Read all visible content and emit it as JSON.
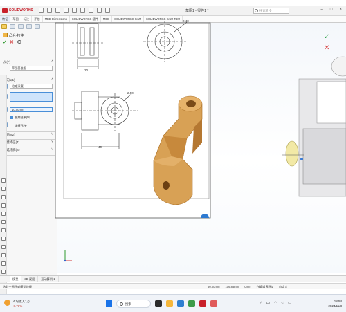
{
  "app": {
    "brand": "SOLIDWORKS",
    "document_title": "草图1 - 零件1 *",
    "search_placeholder": "搜索命令"
  },
  "command_tabs": [
    {
      "label": "特征",
      "active": true
    },
    {
      "label": "草图"
    },
    {
      "label": "标注"
    },
    {
      "label": "评估"
    },
    {
      "label": "MBD Dimensions"
    },
    {
      "label": "SOLIDWORKS 插件"
    },
    {
      "label": "MBD"
    },
    {
      "label": "SOLIDWORKS CAM"
    },
    {
      "label": "SOLIDWORKS CAM TBM"
    }
  ],
  "property_manager": {
    "title": "凸台-拉伸",
    "from_section": "从(F)",
    "from_value": "草图基准面",
    "direction1_section": "方向1(1)",
    "direction1_type": "给定深度",
    "depth_value": "10.00mm",
    "merge_label": "合并结果(M)",
    "draft_label": "拔模开/关",
    "direction2_section": "方向2(2)",
    "thin_section": "薄壁特征(T)",
    "contours_section": "所选轮廓(S)"
  },
  "drawing": {
    "dims": [
      "20",
      "40",
      "2.50",
      "2.30",
      "40",
      "2.40",
      "R",
      "30"
    ]
  },
  "model": {
    "color": "#d49a4a"
  },
  "bottom_tabs": [
    {
      "label": "模型",
      "active": true
    },
    {
      "label": "3D 视图"
    },
    {
      "label": "运动算例 1"
    }
  ],
  "status": {
    "left": "选取一闭环或模型边线",
    "coords": [
      "50.00mm",
      "106.83mm",
      "0mm"
    ],
    "mode": "在编辑 草图1",
    "units": "自定义"
  },
  "taskbar": {
    "weather_line1": "人均收入1万",
    "weather_line2": "-8.73%",
    "search_label": "搜索",
    "time": "18:54",
    "date": "2024/11/8",
    "tray_lang": "中"
  }
}
